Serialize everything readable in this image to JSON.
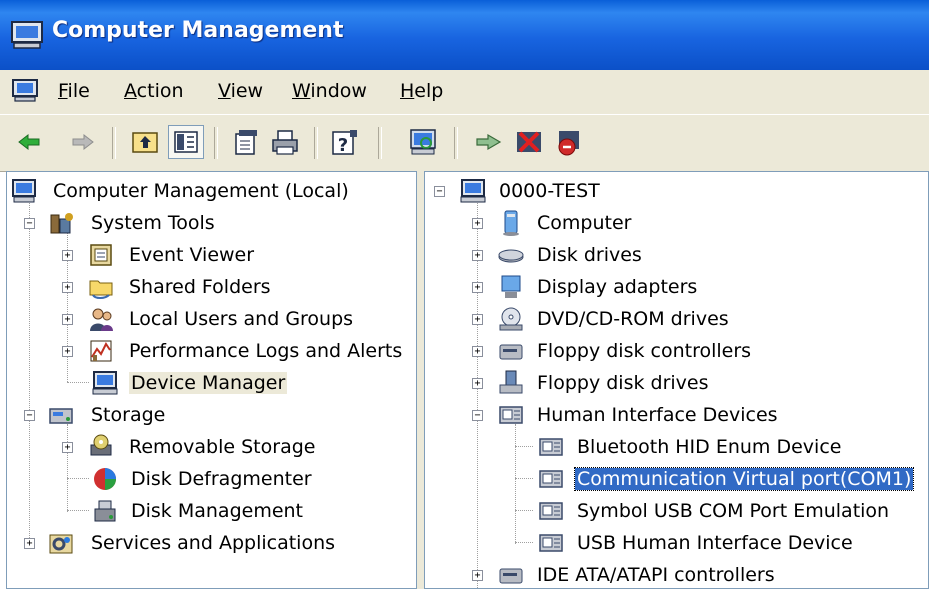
{
  "window": {
    "title": "Computer Management"
  },
  "menubar": {
    "items": [
      "File",
      "Action",
      "View",
      "Window",
      "Help"
    ]
  },
  "toolbar": {
    "buttons": [
      "back-icon",
      "forward-icon",
      "up-folder-icon",
      "show-hide-tree-icon",
      "properties-icon",
      "print-icon",
      "help-icon",
      "scan-hardware-icon",
      "update-driver-icon",
      "disable-device-icon",
      "uninstall-device-icon"
    ]
  },
  "left_tree": {
    "root": "Computer Management (Local)",
    "system_tools": {
      "label": "System Tools",
      "children": [
        "Event Viewer",
        "Shared Folders",
        "Local Users and Groups",
        "Performance Logs and Alerts",
        "Device Manager"
      ]
    },
    "storage": {
      "label": "Storage",
      "children": [
        "Removable Storage",
        "Disk Defragmenter",
        "Disk Management"
      ]
    },
    "services": "Services and Applications",
    "selected": "Device Manager"
  },
  "right_tree": {
    "root": "0000-TEST",
    "categories": [
      "Computer",
      "Disk drives",
      "Display adapters",
      "DVD/CD-ROM drives",
      "Floppy disk controllers",
      "Floppy disk drives",
      "Human Interface Devices"
    ],
    "hid_devices": [
      "Bluetooth HID Enum Device",
      "Communication Virtual port(COM1)",
      "Symbol USB COM Port Emulation",
      "USB Human Interface Device"
    ],
    "after": "IDE ATA/ATAPI controllers",
    "selected": "Communication Virtual port(COM1)"
  },
  "colors": {
    "titlebar": "#0b50c8",
    "chrome": "#ece9d8",
    "selection": "#316ac5"
  }
}
